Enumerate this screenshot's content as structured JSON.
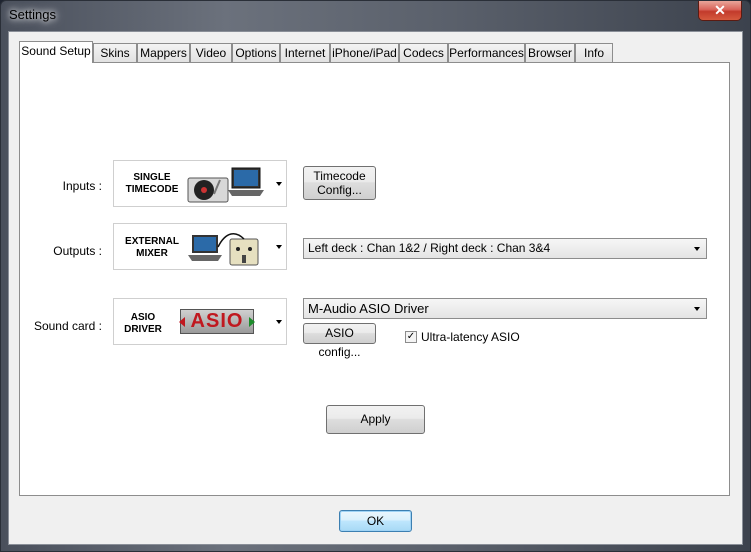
{
  "window": {
    "title": "Settings",
    "close_glyph": "✕"
  },
  "tabs": [
    "Sound Setup",
    "Skins",
    "Mappers",
    "Video",
    "Options",
    "Internet",
    "iPhone/iPad",
    "Codecs",
    "Performances",
    "Browser",
    "Info"
  ],
  "inputs": {
    "label": "Inputs :",
    "image_text": "SINGLE TIMECODE",
    "button_label": "Timecode Config..."
  },
  "outputs": {
    "label": "Outputs :",
    "image_text": "EXTERNAL MIXER",
    "select_value": "Left deck : Chan 1&2 / Right deck : Chan 3&4"
  },
  "soundcard": {
    "label": "Sound card :",
    "image_text": "ASIO DRIVER",
    "logo_text": "ASIO",
    "select_value": "M-Audio ASIO Driver",
    "config_button": "ASIO config...",
    "checkbox_label": "Ultra-latency ASIO",
    "checkbox_checked": true,
    "check_glyph": "✓"
  },
  "apply_label": "Apply",
  "ok_label": "OK",
  "colors": {
    "ok_border": "#3c7fb1",
    "logo_red": "#c0181f",
    "logo_green": "#1c8c2a"
  }
}
